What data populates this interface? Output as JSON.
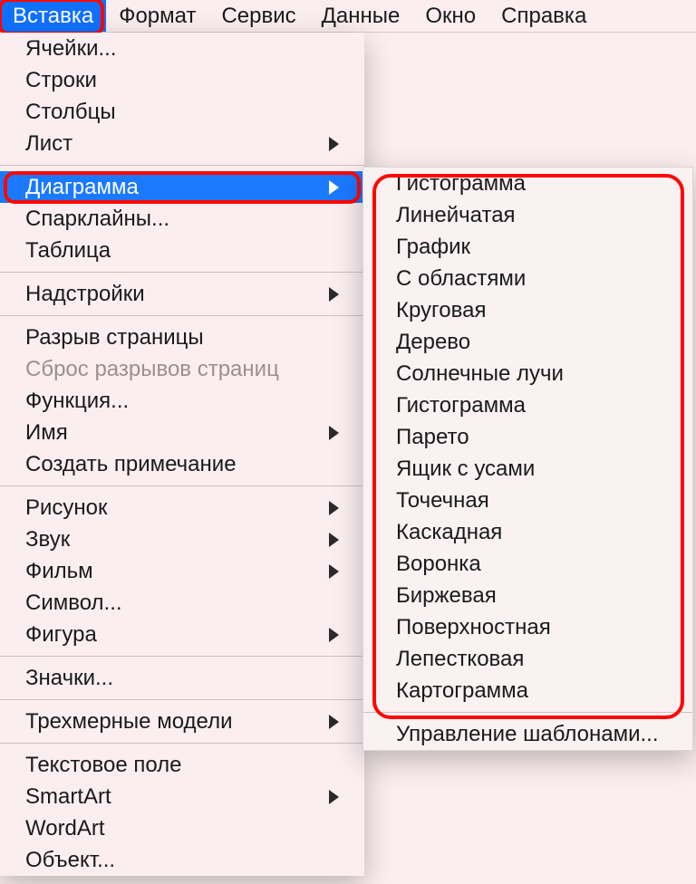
{
  "menubar": {
    "items": [
      {
        "label": "Вставка",
        "selected": true
      },
      {
        "label": "Формат",
        "selected": false
      },
      {
        "label": "Сервис",
        "selected": false
      },
      {
        "label": "Данные",
        "selected": false
      },
      {
        "label": "Окно",
        "selected": false
      },
      {
        "label": "Справка",
        "selected": false
      }
    ]
  },
  "dropdown": {
    "groups": [
      [
        {
          "label": "Ячейки...",
          "hasSubmenu": false,
          "disabled": false,
          "highlighted": false
        },
        {
          "label": "Строки",
          "hasSubmenu": false,
          "disabled": false,
          "highlighted": false
        },
        {
          "label": "Столбцы",
          "hasSubmenu": false,
          "disabled": false,
          "highlighted": false
        },
        {
          "label": "Лист",
          "hasSubmenu": true,
          "disabled": false,
          "highlighted": false
        }
      ],
      [
        {
          "label": "Диаграмма",
          "hasSubmenu": true,
          "disabled": false,
          "highlighted": true,
          "outlined": true
        },
        {
          "label": "Спарклайны...",
          "hasSubmenu": false,
          "disabled": false,
          "highlighted": false
        },
        {
          "label": "Таблица",
          "hasSubmenu": false,
          "disabled": false,
          "highlighted": false
        }
      ],
      [
        {
          "label": "Надстройки",
          "hasSubmenu": true,
          "disabled": false,
          "highlighted": false
        }
      ],
      [
        {
          "label": "Разрыв страницы",
          "hasSubmenu": false,
          "disabled": false,
          "highlighted": false
        },
        {
          "label": "Сброс разрывов страниц",
          "hasSubmenu": false,
          "disabled": true,
          "highlighted": false
        },
        {
          "label": "Функция...",
          "hasSubmenu": false,
          "disabled": false,
          "highlighted": false
        },
        {
          "label": "Имя",
          "hasSubmenu": true,
          "disabled": false,
          "highlighted": false
        },
        {
          "label": "Создать примечание",
          "hasSubmenu": false,
          "disabled": false,
          "highlighted": false
        }
      ],
      [
        {
          "label": "Рисунок",
          "hasSubmenu": true,
          "disabled": false,
          "highlighted": false
        },
        {
          "label": "Звук",
          "hasSubmenu": true,
          "disabled": false,
          "highlighted": false
        },
        {
          "label": "Фильм",
          "hasSubmenu": true,
          "disabled": false,
          "highlighted": false
        },
        {
          "label": "Символ...",
          "hasSubmenu": false,
          "disabled": false,
          "highlighted": false
        },
        {
          "label": "Фигура",
          "hasSubmenu": true,
          "disabled": false,
          "highlighted": false
        }
      ],
      [
        {
          "label": "Значки...",
          "hasSubmenu": false,
          "disabled": false,
          "highlighted": false
        }
      ],
      [
        {
          "label": "Трехмерные модели",
          "hasSubmenu": true,
          "disabled": false,
          "highlighted": false
        }
      ],
      [
        {
          "label": "Текстовое поле",
          "hasSubmenu": false,
          "disabled": false,
          "highlighted": false
        },
        {
          "label": "SmartArt",
          "hasSubmenu": true,
          "disabled": false,
          "highlighted": false
        },
        {
          "label": "WordArt",
          "hasSubmenu": false,
          "disabled": false,
          "highlighted": false
        },
        {
          "label": "Объект...",
          "hasSubmenu": false,
          "disabled": false,
          "highlighted": false
        }
      ]
    ]
  },
  "submenu": {
    "chart_types": [
      "Гистограмма",
      "Линейчатая",
      "График",
      "С областями",
      "Круговая",
      "Дерево",
      "Солнечные лучи",
      "Гистограмма",
      "Парето",
      "Ящик с усами",
      "Точечная",
      "Каскадная",
      "Воронка",
      "Биржевая",
      "Поверхностная",
      "Лепестковая",
      "Картограмма"
    ],
    "manage_templates": "Управление шаблонами..."
  }
}
